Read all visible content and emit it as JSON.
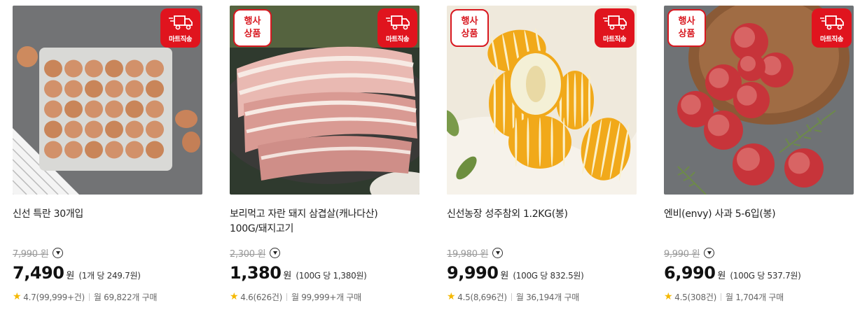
{
  "products": [
    {
      "title_lines": [
        "신선 특란 30개입",
        ""
      ],
      "event_badge": null,
      "direct_badge": "마트직송",
      "original_price": "7,990",
      "original_won": "원",
      "price": "7,490",
      "won": "원",
      "unit_price": "(1개 당 249.7원)",
      "rating": "4.7(99,999+건)",
      "monthly": "월 69,822개 구매"
    },
    {
      "title_lines": [
        "보리먹고 자란 돼지 삼겹살(캐나다산)",
        "100G/돼지고기"
      ],
      "event_badge": [
        "행사",
        "상품"
      ],
      "direct_badge": "마트직송",
      "original_price": "2,300",
      "original_won": "원",
      "price": "1,380",
      "won": "원",
      "unit_price": "(100G 당 1,380원)",
      "rating": "4.6(626건)",
      "monthly": "월 99,999+개 구매"
    },
    {
      "title_lines": [
        "신선농장 성주참외 1.2KG(봉)",
        ""
      ],
      "event_badge": [
        "행사",
        "상품"
      ],
      "direct_badge": "마트직송",
      "original_price": "19,980",
      "original_won": "원",
      "price": "9,990",
      "won": "원",
      "unit_price": "(100G 당 832.5원)",
      "rating": "4.5(8,696건)",
      "monthly": "월 36,194개 구매"
    },
    {
      "title_lines": [
        "엔비(envy) 사과 5-6입(봉)",
        ""
      ],
      "event_badge": [
        "행사",
        "상품"
      ],
      "direct_badge": "마트직송",
      "original_price": "9,990",
      "original_won": "원",
      "price": "6,990",
      "won": "원",
      "unit_price": "(100G 당 537.7원)",
      "rating": "4.5(308건)",
      "monthly": "월 1,704개 구매"
    }
  ],
  "icons": {
    "truck": "delivery-truck-icon",
    "info": "chevron-down-circle-icon",
    "star": "star-icon"
  },
  "colors": {
    "brand_red": "#e0141e",
    "star": "#f5b800",
    "strike": "#999999"
  }
}
